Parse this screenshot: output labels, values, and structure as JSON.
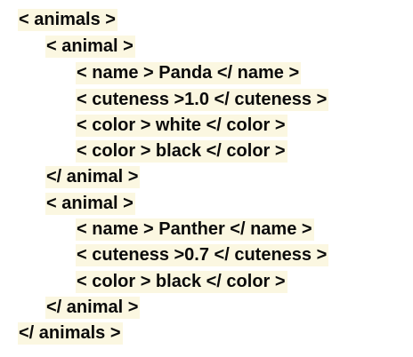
{
  "lines": [
    {
      "text": "< animals >",
      "level": 0
    },
    {
      "text": "< animal >",
      "level": 1
    },
    {
      "text": "< name > Panda </ name >",
      "level": 2
    },
    {
      "text": "< cuteness >1.0 </ cuteness >",
      "level": 2
    },
    {
      "text": "< color > white </ color >",
      "level": 2
    },
    {
      "text": "< color > black </ color >",
      "level": 2
    },
    {
      "text": "</ animal >",
      "level": 1
    },
    {
      "text": "< animal >",
      "level": 1
    },
    {
      "text": "< name > Panther </ name >",
      "level": 2
    },
    {
      "text": "< cuteness >0.7 </ cuteness >",
      "level": 2
    },
    {
      "text": "< color > black </ color >",
      "level": 2
    },
    {
      "text": "</ animal >",
      "level": 1
    },
    {
      "text": "</ animals >",
      "level": 0
    }
  ],
  "colors": {
    "text": "#0a0a0a",
    "highlight": "#fbf7e1",
    "background": "#ffffff"
  }
}
